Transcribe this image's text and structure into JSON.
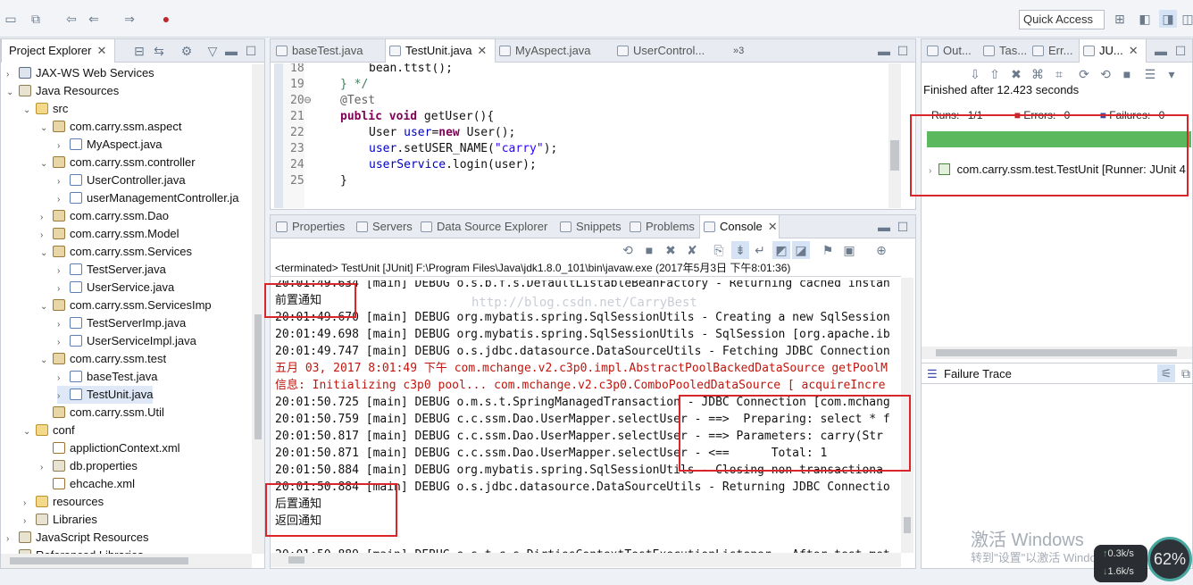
{
  "toolbar": {
    "quick_access": "Quick Access"
  },
  "project_explorer": {
    "title": "Project Explorer",
    "items": [
      {
        "label": "JAX-WS Web Services",
        "depth": 1,
        "twisty": "›",
        "icon": "ws"
      },
      {
        "label": "Java Resources",
        "depth": 1,
        "twisty": "⌄",
        "icon": "lib"
      },
      {
        "label": "src",
        "depth": 2,
        "twisty": "⌄",
        "icon": "folder"
      },
      {
        "label": "com.carry.ssm.aspect",
        "depth": 3,
        "twisty": "⌄",
        "icon": "pkg"
      },
      {
        "label": "MyAspect.java",
        "depth": 4,
        "twisty": "›",
        "icon": "java"
      },
      {
        "label": "com.carry.ssm.controller",
        "depth": 3,
        "twisty": "⌄",
        "icon": "pkg"
      },
      {
        "label": "UserController.java",
        "depth": 4,
        "twisty": "›",
        "icon": "java"
      },
      {
        "label": "userManagementController.ja",
        "depth": 4,
        "twisty": "›",
        "icon": "java"
      },
      {
        "label": "com.carry.ssm.Dao",
        "depth": 3,
        "twisty": "›",
        "icon": "pkg"
      },
      {
        "label": "com.carry.ssm.Model",
        "depth": 3,
        "twisty": "›",
        "icon": "pkg"
      },
      {
        "label": "com.carry.ssm.Services",
        "depth": 3,
        "twisty": "⌄",
        "icon": "pkg"
      },
      {
        "label": "TestServer.java",
        "depth": 4,
        "twisty": "›",
        "icon": "java"
      },
      {
        "label": "UserService.java",
        "depth": 4,
        "twisty": "›",
        "icon": "java"
      },
      {
        "label": "com.carry.ssm.ServicesImp",
        "depth": 3,
        "twisty": "⌄",
        "icon": "pkg"
      },
      {
        "label": "TestServerImp.java",
        "depth": 4,
        "twisty": "›",
        "icon": "java"
      },
      {
        "label": "UserServiceImpl.java",
        "depth": 4,
        "twisty": "›",
        "icon": "java"
      },
      {
        "label": "com.carry.ssm.test",
        "depth": 3,
        "twisty": "⌄",
        "icon": "pkg"
      },
      {
        "label": "baseTest.java",
        "depth": 4,
        "twisty": "›",
        "icon": "java"
      },
      {
        "label": "TestUnit.java",
        "depth": 4,
        "twisty": "›",
        "icon": "java",
        "selected": true
      },
      {
        "label": "com.carry.ssm.Util",
        "depth": 3,
        "twisty": "",
        "icon": "pkg"
      },
      {
        "label": "conf",
        "depth": 2,
        "twisty": "⌄",
        "icon": "folder"
      },
      {
        "label": "applictionContext.xml",
        "depth": 3,
        "twisty": "",
        "icon": "xml"
      },
      {
        "label": "db.properties",
        "depth": 3,
        "twisty": "›",
        "icon": "lib"
      },
      {
        "label": "ehcache.xml",
        "depth": 3,
        "twisty": "",
        "icon": "xml"
      },
      {
        "label": "resources",
        "depth": 2,
        "twisty": "›",
        "icon": "folder"
      },
      {
        "label": "Libraries",
        "depth": 2,
        "twisty": "›",
        "icon": "lib"
      },
      {
        "label": "JavaScript Resources",
        "depth": 1,
        "twisty": "›",
        "icon": "lib"
      },
      {
        "label": "Referenced Libraries",
        "depth": 1,
        "twisty": "›",
        "icon": "lib"
      }
    ]
  },
  "editor": {
    "tabs": [
      {
        "label": "baseTest.java"
      },
      {
        "label": "TestUnit.java",
        "active": true
      },
      {
        "label": "MyAspect.java"
      },
      {
        "label": "UserControl..."
      }
    ],
    "overflow": "»3",
    "lines": [
      {
        "num": "18",
        "html_key": "l18"
      },
      {
        "num": "19",
        "html_key": "l19"
      },
      {
        "num": "20⊖",
        "html_key": "l20"
      },
      {
        "num": "21",
        "html_key": "l21"
      },
      {
        "num": "22",
        "html_key": "l22"
      },
      {
        "num": "23",
        "html_key": "l23"
      },
      {
        "num": "24",
        "html_key": "l24"
      },
      {
        "num": "25",
        "html_key": "l25"
      }
    ],
    "code": {
      "l18": "bean.ttst();",
      "l19": "} */",
      "l20": "@Test",
      "l21_kw": "public void",
      "l21_rest": " getUser(){",
      "l22_a": "User ",
      "l22_fld": "user",
      "l22_b": "=",
      "l22_kw": "new",
      "l22_c": " User();",
      "l23_fld": "user",
      "l23_a": ".setUSER_NAME(",
      "l23_str": "\"carry\"",
      "l23_b": ");",
      "l24_fld": "userService",
      "l24_a": ".login(user);",
      "l25": "}"
    }
  },
  "bottom_panel": {
    "tabs": [
      {
        "label": "Properties"
      },
      {
        "label": "Servers"
      },
      {
        "label": "Data Source Explorer"
      },
      {
        "label": "Snippets"
      },
      {
        "label": "Problems"
      },
      {
        "label": "Console",
        "active": true
      }
    ],
    "header": "<terminated> TestUnit [JUnit] F:\\Program Files\\Java\\jdk1.8.0_101\\bin\\javaw.exe (2017年5月3日 下午8:01:36)",
    "watermark": "http://blog.csdn.net/CarryBest",
    "lines": [
      {
        "text": "20:01:49.634 [main] DEBUG o.s.b.f.s.DefaultListableBeanFactory - Returning cached instan",
        "red": false
      },
      {
        "text": "前置通知",
        "red": false
      },
      {
        "text": "20:01:49.670 [main] DEBUG org.mybatis.spring.SqlSessionUtils - Creating a new SqlSession",
        "red": false
      },
      {
        "text": "20:01:49.698 [main] DEBUG org.mybatis.spring.SqlSessionUtils - SqlSession [org.apache.ib",
        "red": false
      },
      {
        "text": "20:01:49.747 [main] DEBUG o.s.jdbc.datasource.DataSourceUtils - Fetching JDBC Connection",
        "red": false
      },
      {
        "text": "五月 03, 2017 8:01:49 下午 com.mchange.v2.c3p0.impl.AbstractPoolBackedDataSource getPoolM",
        "red": true
      },
      {
        "text": "信息: Initializing c3p0 pool... com.mchange.v2.c3p0.ComboPooledDataSource [ acquireIncre",
        "red": true
      },
      {
        "text": "20:01:50.725 [main] DEBUG o.m.s.t.SpringManagedTransaction - JDBC Connection [com.mchang",
        "red": false
      },
      {
        "text": "20:01:50.759 [main] DEBUG c.c.ssm.Dao.UserMapper.selectUser - ==>  Preparing: select * f",
        "red": false
      },
      {
        "text": "20:01:50.817 [main] DEBUG c.c.ssm.Dao.UserMapper.selectUser - ==> Parameters: carry(Str",
        "red": false
      },
      {
        "text": "20:01:50.871 [main] DEBUG c.c.ssm.Dao.UserMapper.selectUser - <==      Total: 1",
        "red": false
      },
      {
        "text": "20:01:50.884 [main] DEBUG org.mybatis.spring.SqlSessionUtils - Closing non transactiona",
        "red": false
      },
      {
        "text": "20:01:50.884 [main] DEBUG o.s.jdbc.datasource.DataSourceUtils - Returning JDBC Connectio",
        "red": false
      },
      {
        "text": "后置通知",
        "red": false
      },
      {
        "text": "返回通知",
        "red": false
      },
      {
        "text": "",
        "red": false
      },
      {
        "text": "20:01:50.889 [main] DEBUG o.s.t.c.s.DirtiesContextTestExecutionListener - After test met",
        "red": false
      }
    ]
  },
  "junit": {
    "tabs": [
      {
        "label": "Out..."
      },
      {
        "label": "Tas..."
      },
      {
        "label": "Err..."
      },
      {
        "label": "JU...",
        "active": true
      }
    ],
    "finished": "Finished after 12.423 seconds",
    "runs_label": "Runs:",
    "runs_value": "1/1",
    "errors_label": "Errors:",
    "errors_value": "0",
    "failures_label": "Failures:",
    "failures_value": "0",
    "progress": 1.0,
    "progress_color": "#5cb85c",
    "test_item": "com.carry.ssm.test.TestUnit [Runner: JUnit 4",
    "failure_trace": "Failure Trace"
  },
  "os_overlay": {
    "activate_title": "激活 Windows",
    "activate_sub": "转到\"设置\"以激活 Windows。",
    "net_up": "0.3k/s",
    "net_down": "1.6k/s",
    "percent": "62%"
  },
  "colors": {
    "annotation_box": "#d9262b",
    "console_error": "#c0160e"
  }
}
